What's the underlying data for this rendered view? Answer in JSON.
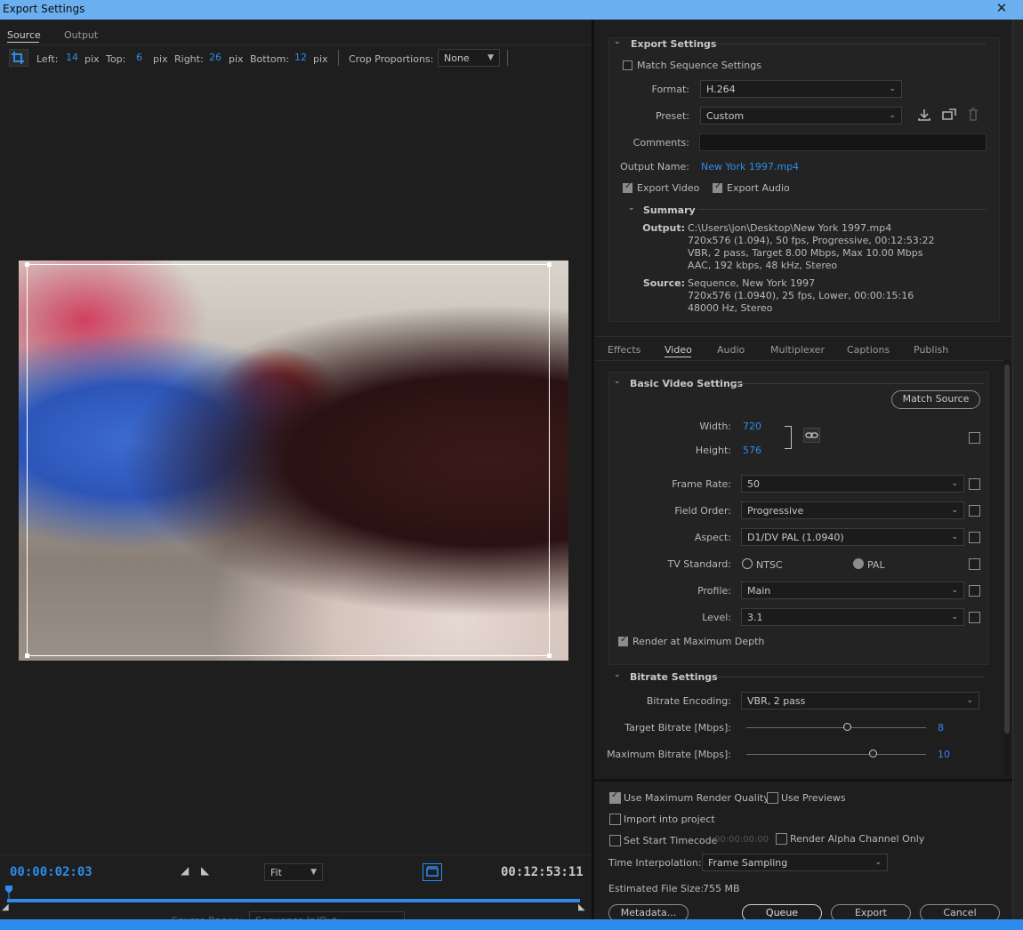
{
  "window": {
    "title": "Export Settings",
    "close": "✕"
  },
  "source_tabs": {
    "source": "Source",
    "output": "Output"
  },
  "crop": {
    "left_label": "Left:",
    "left_value": "14",
    "left_unit": "pix",
    "top_label": "Top:",
    "top_value": "6",
    "top_unit": "pix",
    "right_label": "Right:",
    "right_value": "26",
    "right_unit": "pix",
    "bottom_label": "Bottom:",
    "bottom_value": "12",
    "bottom_unit": "pix",
    "proportions_label": "Crop Proportions:",
    "proportions_value": "None"
  },
  "timeline": {
    "current_time": "00:00:02:03",
    "fit_value": "Fit",
    "duration": "00:12:53:11",
    "source_range_label": "Source Range:",
    "source_range_value": "Sequence In/Out",
    "playhead_fraction": 0.0
  },
  "export_settings": {
    "section_title": "Export Settings",
    "match_sequence": "Match Sequence Settings",
    "format_label": "Format:",
    "format_value": "H.264",
    "preset_label": "Preset:",
    "preset_value": "Custom",
    "comments_label": "Comments:",
    "comments_value": "",
    "output_name_label": "Output Name:",
    "output_name_value": "New York 1997.mp4",
    "export_video": "Export Video",
    "export_audio": "Export Audio",
    "summary_title": "Summary",
    "output_label": "Output:",
    "output_lines": [
      "C:\\Users\\jon\\Desktop\\New York 1997.mp4",
      "720x576 (1.094), 50 fps, Progressive, 00:12:53:22",
      "VBR, 2 pass, Target 8.00 Mbps, Max 10.00 Mbps",
      "AAC, 192 kbps, 48 kHz, Stereo"
    ],
    "source_label": "Source:",
    "source_lines": [
      "Sequence, New York 1997",
      "720x576 (1.0940), 25 fps, Lower, 00:00:15:16",
      "48000 Hz, Stereo"
    ]
  },
  "settings_tabs": [
    "Effects",
    "Video",
    "Audio",
    "Multiplexer",
    "Captions",
    "Publish"
  ],
  "video": {
    "basic_title": "Basic Video Settings",
    "match_source": "Match Source",
    "width_label": "Width:",
    "width_value": "720",
    "height_label": "Height:",
    "height_value": "576",
    "frame_rate_label": "Frame Rate:",
    "frame_rate_value": "50",
    "field_order_label": "Field Order:",
    "field_order_value": "Progressive",
    "aspect_label": "Aspect:",
    "aspect_value": "D1/DV PAL (1.0940)",
    "tv_label": "TV Standard:",
    "tv_ntsc": "NTSC",
    "tv_pal": "PAL",
    "profile_label": "Profile:",
    "profile_value": "Main",
    "level_label": "Level:",
    "level_value": "3.1",
    "render_max_depth": "Render at Maximum Depth",
    "bitrate_title": "Bitrate Settings",
    "bitrate_encoding_label": "Bitrate Encoding:",
    "bitrate_encoding_value": "VBR, 2 pass",
    "target_bitrate_label": "Target Bitrate [Mbps]:",
    "target_bitrate_value": "8",
    "max_bitrate_label": "Maximum Bitrate [Mbps]:",
    "max_bitrate_value": "10"
  },
  "bottom": {
    "use_max_render": "Use Maximum Render Quality",
    "use_previews": "Use Previews",
    "import_project": "Import into project",
    "set_start_tc": "Set Start Timecode",
    "start_tc_value": "00:00:00:00",
    "render_alpha": "Render Alpha Channel Only",
    "time_interp_label": "Time Interpolation:",
    "time_interp_value": "Frame Sampling",
    "est_size_label": "Estimated File Size:",
    "est_size_value": "755 MB",
    "metadata": "Metadata...",
    "queue": "Queue",
    "export": "Export",
    "cancel": "Cancel"
  },
  "colors": {
    "accent": "#2d8ceb",
    "titlebar": "#6ab0f0",
    "background": "#1e1e1e"
  }
}
